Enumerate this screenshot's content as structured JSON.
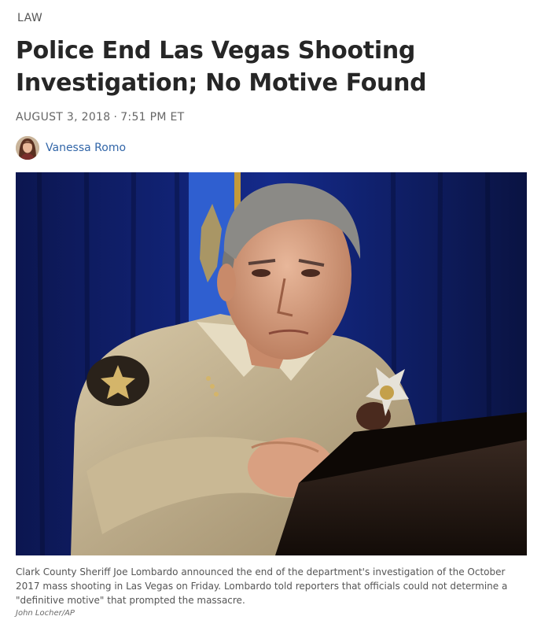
{
  "article": {
    "section": "LAW",
    "headline": "Police End Las Vegas Shooting Investigation; No Motive Found",
    "date": "AUGUST 3, 2018",
    "separator": "·",
    "time": "7:51 PM ET",
    "author": "Vanessa Romo",
    "image": {
      "caption": "Clark County Sheriff Joe Lombardo announced the end of the department's investigation of the October 2017 mass shooting in Las Vegas on Friday. Lombardo told reporters that officials could not determine a \"definitive motive\" that prompted the massacre.",
      "credit": "John Locher/AP"
    }
  },
  "colors": {
    "author_link": "#3266a8",
    "headline": "#262626",
    "meta": "#666666"
  },
  "icons": {
    "avatar": "author-avatar-photo"
  }
}
